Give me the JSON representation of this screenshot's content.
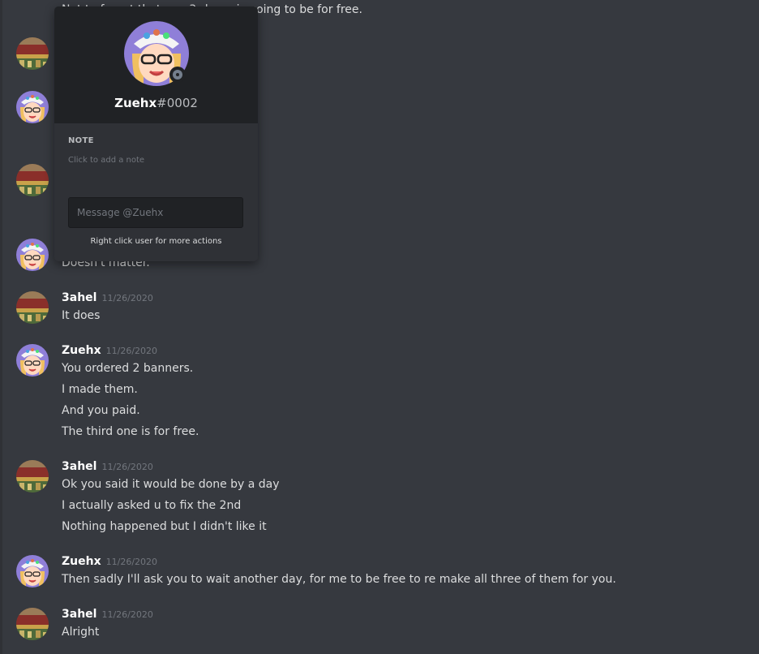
{
  "colors": {
    "background": "#36393f",
    "popout_bg": "#2f3136",
    "popout_header_bg": "#202225",
    "username": "#ffffff",
    "timestamp": "#72767d",
    "status_offline": "#747f8d"
  },
  "partial_top_line": "Not to forget that one 3rd one is going to be for free.",
  "popout": {
    "username": "Zuehx",
    "discriminator": "#0002",
    "note_label": "NOTE",
    "note_placeholder": "Click to add a note",
    "message_placeholder": "Message @Zuehx",
    "hint": "Right click user for more actions"
  },
  "partial_message": "Doesn't matter.",
  "messages": [
    {
      "author": "3ahel",
      "timestamp": "11/26/2020",
      "lines": [
        "It does"
      ]
    },
    {
      "author": "Zuehx",
      "timestamp": "11/26/2020",
      "lines": [
        "You ordered 2 banners.",
        "I made them.",
        "And you paid.",
        "The third one is for free."
      ]
    },
    {
      "author": "3ahel",
      "timestamp": "11/26/2020",
      "lines": [
        "Ok you said it would be done by a day",
        "I actually asked u to fix the 2nd",
        "Nothing happened but I didn't like it"
      ]
    },
    {
      "author": "Zuehx",
      "timestamp": "11/26/2020",
      "lines": [
        "Then sadly I'll ask you to wait another day, for me to be free to re make all three of them for you."
      ]
    },
    {
      "author": "3ahel",
      "timestamp": "11/26/2020",
      "lines": [
        "Alright"
      ]
    }
  ]
}
